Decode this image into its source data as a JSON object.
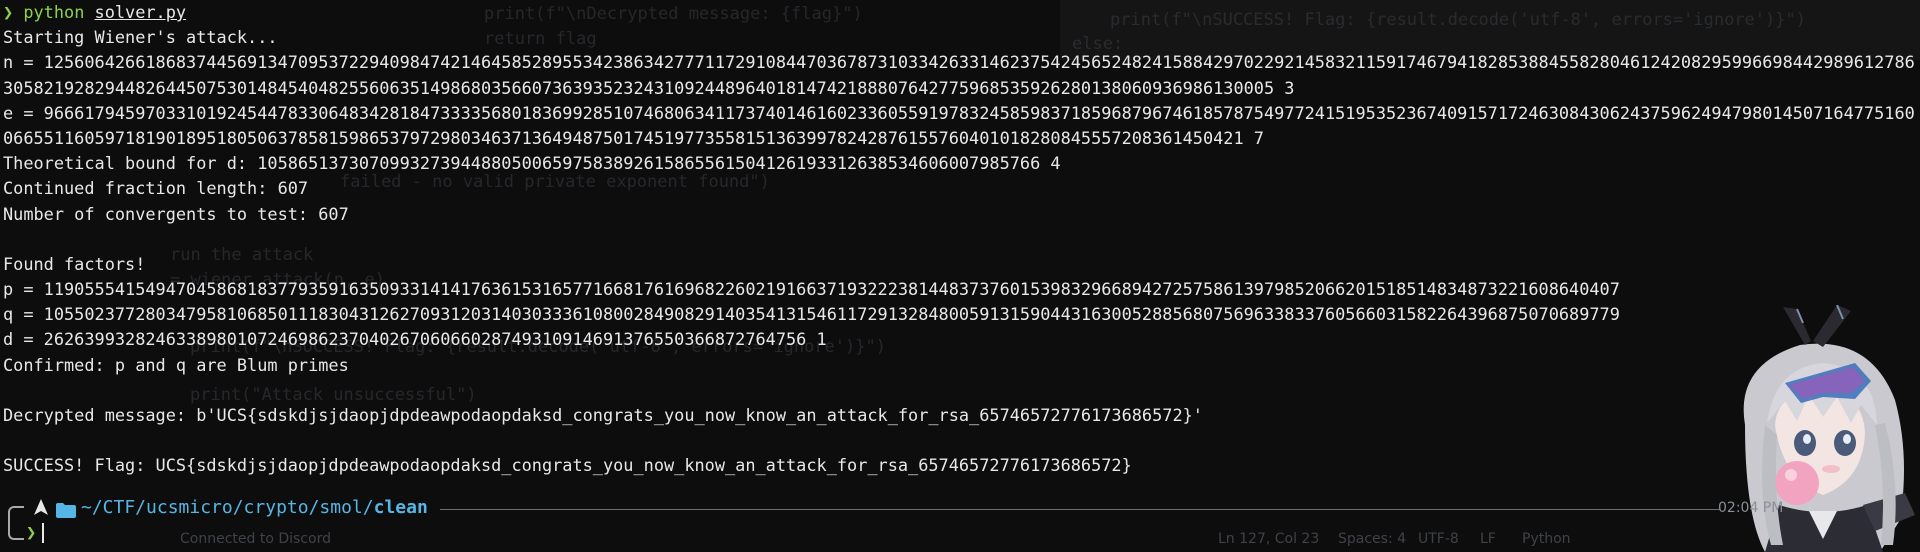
{
  "terminal": {
    "command": {
      "arrow": "❯",
      "program": "python",
      "file": "solver.py"
    },
    "output": [
      "Starting Wiener's attack...",
      "n = 125606426618683744569134709537229409847421464585289553423863427771172910844703678731033426331462375424565248241588429702292145832115917467941828538845582804612420829599669844298961278630582192829448264450753014845404825560635149868035660736393523243109244896401814742188807642775968535926280138060936986130005 3",
      "e = 966617945970331019245447833064834281847333356801836992851074680634117374014616023360559197832458598371859687967461857875497724151953523674091571724630843062437596249479801450716477516006655116059718190189518050637858159865379729803463713649487501745197735581513639978242876155760401018280845557208361450421 7",
      "Theoretical bound for d: 10586513730709932739448805006597583892615865561504126193312638534606007985766 4",
      "Continued fraction length: 607",
      "Number of convergents to test: 607",
      "",
      "Found factors!",
      "p = 11905554154947045868183779359163509331414176361531657716681761696822602191663719322238144837376015398329668942725758613979852066201518514834873221608640407",
      "q = 10550237728034795810685011183043126270931203140303336108002849082914035413154611729132848005913159044316300528856807569633833760566031582264396875070689779",
      "d = 262639932824633898010724698623704026706066028749310914691376550366872764756 1",
      "Confirmed: p and q are Blum primes",
      "",
      "Decrypted message: b'UCS{sdskdjsjdaopjdpdeawpodaopdaksd_congrats_you_now_know_an_attack_for_rsa_65746572776173686572}'",
      "",
      "SUCCESS! Flag: UCS{sdskdjsjdaopjdpdeawpodaopdaksd_congrats_you_now_know_an_attack_for_rsa_65746572776173686572}"
    ]
  },
  "prompt": {
    "path_prefix": "~/CTF/ucsmicro/crypto/smol/",
    "path_leaf": "clean",
    "line2_arrow": "❯",
    "clock": "02:04 PM"
  },
  "background": {
    "code_lines": [
      "print(f\"\\nDecrypted message: {flag}\")",
      "return flag",
      "print(f\"\\nSUCCESS! Flag: {result.decode('utf-8', errors='ignore')}\")",
      "else:",
      "failed - no valid private exponent found\")",
      "run the attack",
      "= wiener_attack(n, e)",
      "print(\"Attack unsuccessful\")",
      "print(f\"\\nSUCCESS! Flag: {result.decode('utf-8', errors='ignore')}\")"
    ],
    "status": {
      "connected": "Connected to Discord",
      "position": "Ln 127, Col 23",
      "spaces": "Spaces: 4",
      "encoding": "UTF-8",
      "eol": "LF",
      "language": "Python"
    }
  },
  "colors": {
    "background": "#0d0d0d",
    "text": "#e8e8e8",
    "accent_green": "#8bd34c",
    "path_blue": "#55b6e6"
  }
}
